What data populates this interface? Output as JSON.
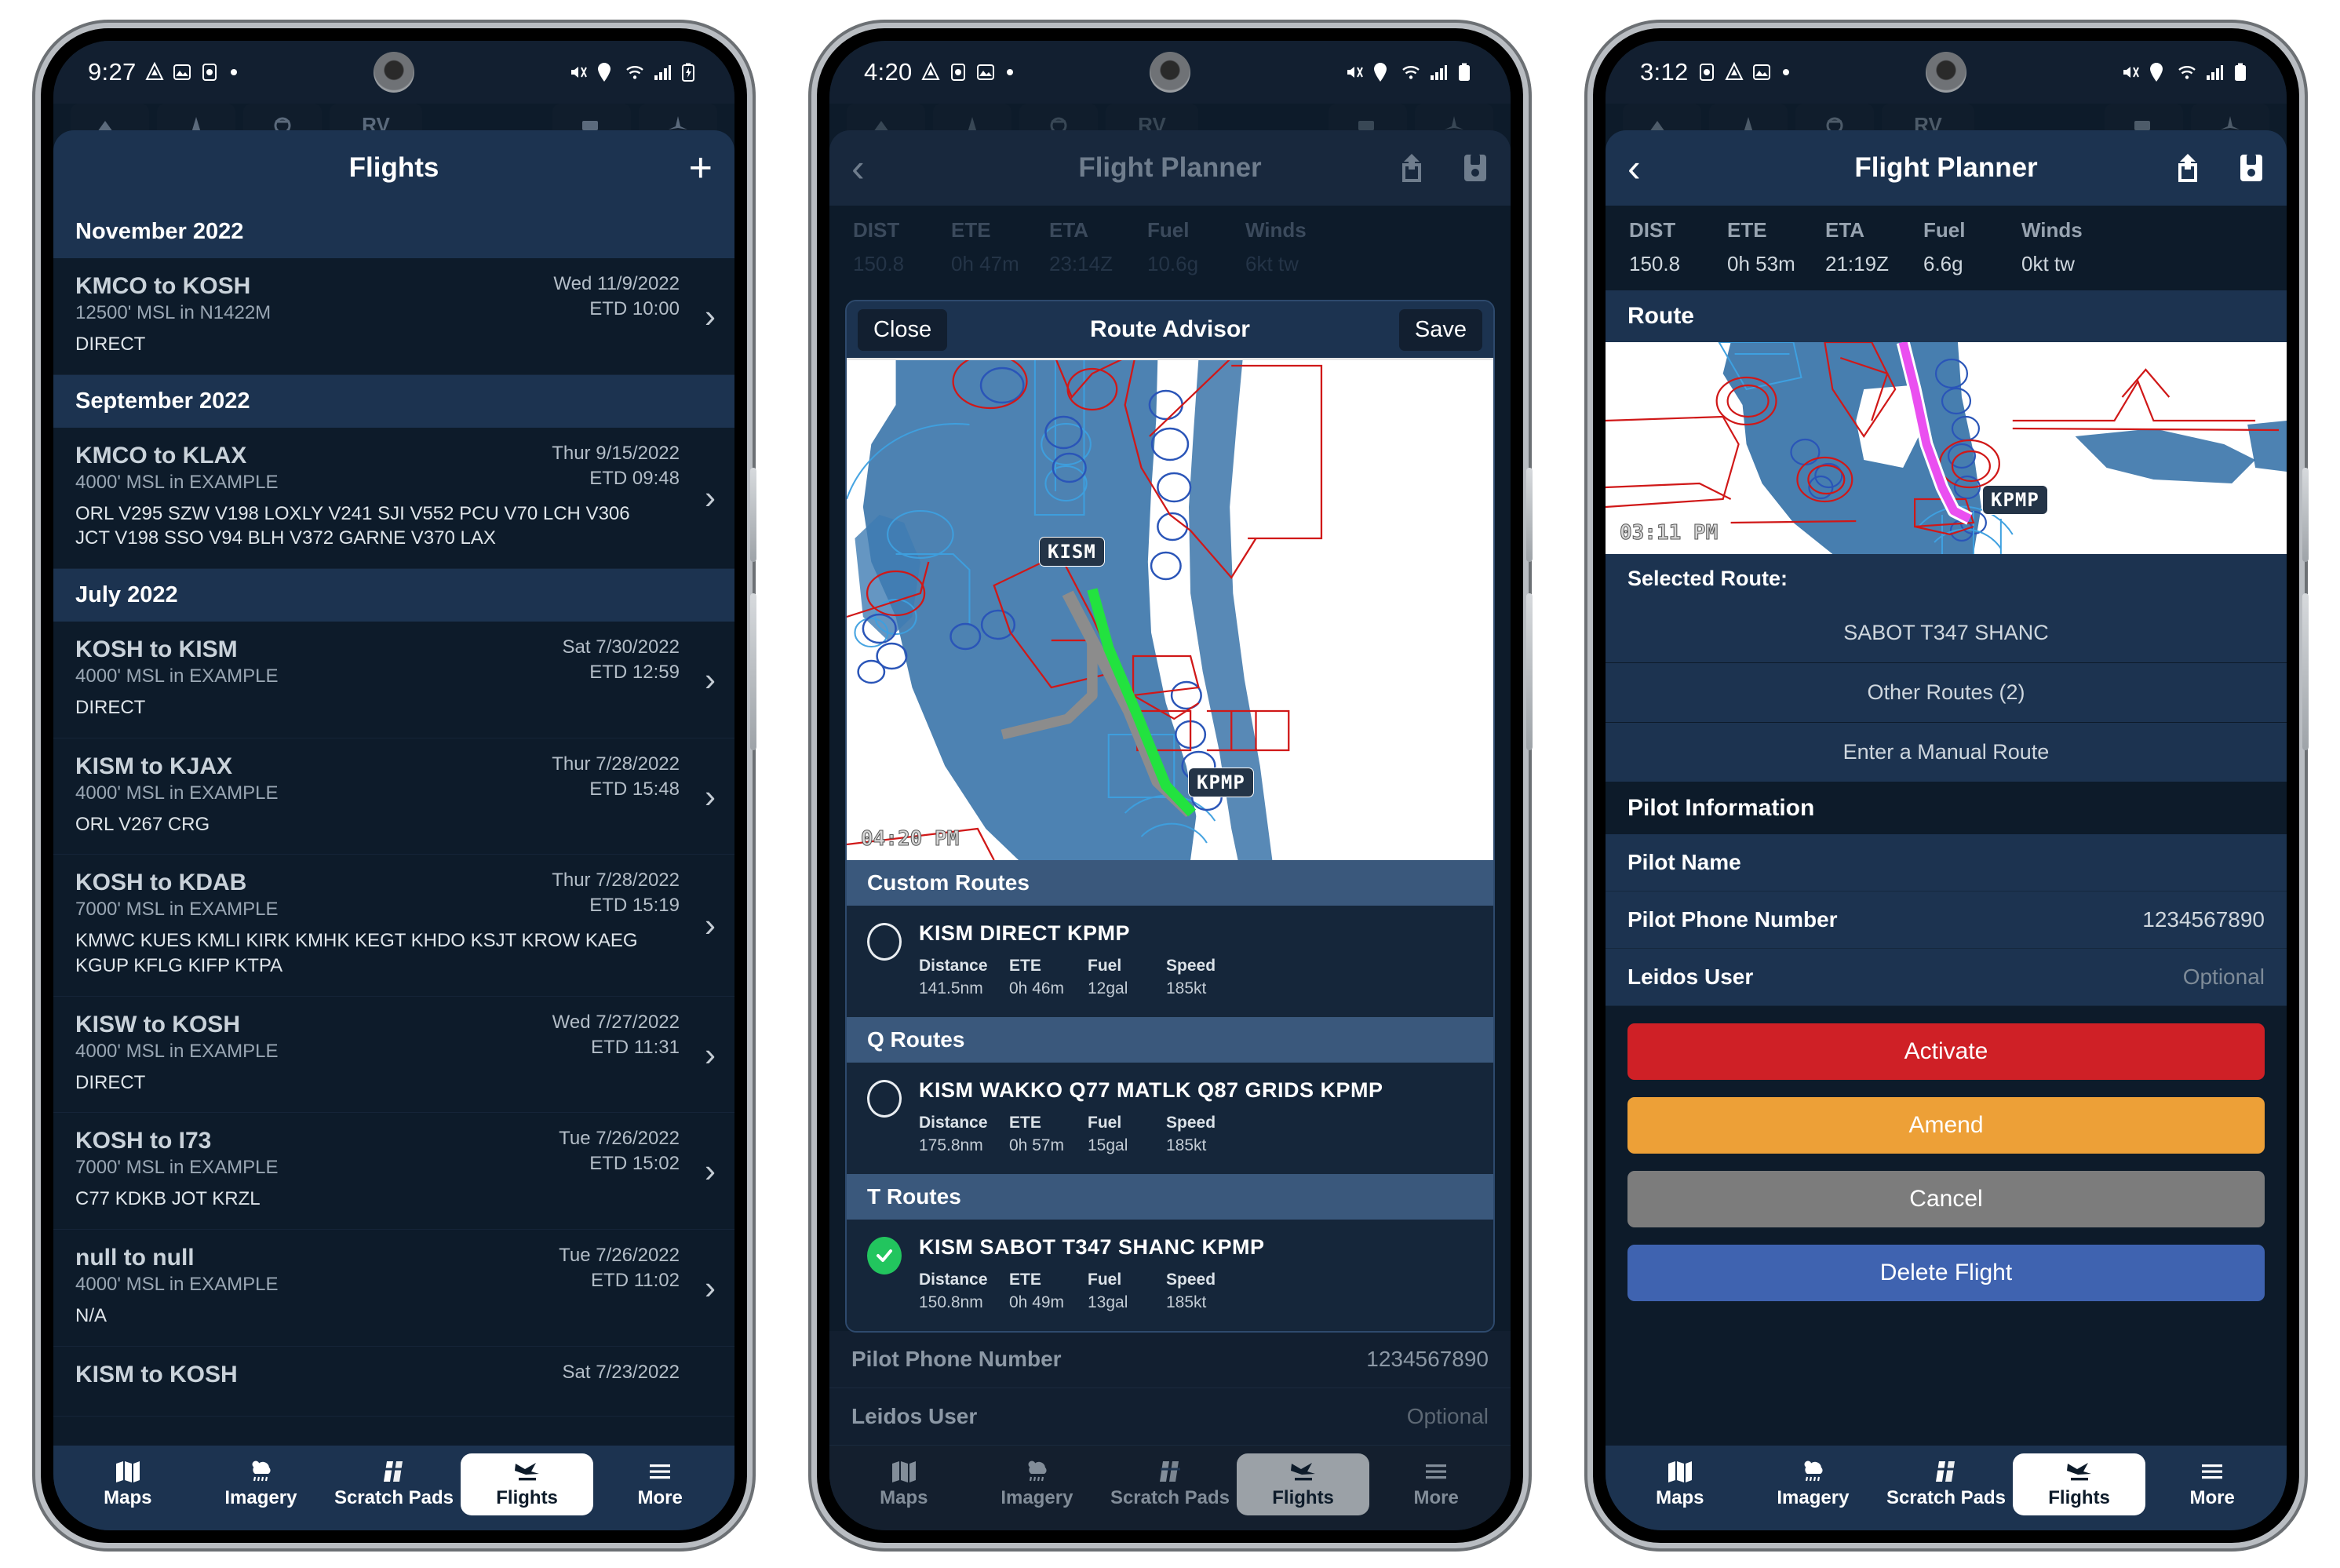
{
  "phone1": {
    "status_bar": {
      "time": "9:27",
      "icons": [
        "drive-icon",
        "photos-icon",
        "clock-icon",
        "dot-icon"
      ],
      "right_icons": [
        "mute-icon",
        "location-icon",
        "wifi-icon",
        "signal-icon",
        "battery-charging-icon"
      ]
    },
    "appbar": {
      "title": "Flights",
      "add_label": "+"
    },
    "sections": [
      {
        "month": "November 2022",
        "flights": [
          {
            "route": "KMCO to KOSH",
            "altitude": "12500' MSL in N1422M",
            "waypoints": "DIRECT",
            "date": "Wed 11/9/2022",
            "etd": "ETD 10:00"
          }
        ]
      },
      {
        "month": "September 2022",
        "flights": [
          {
            "route": "KMCO to KLAX",
            "altitude": "4000' MSL in EXAMPLE",
            "waypoints": "ORL V295 SZW V198 LOXLY V241 SJI V552 PCU V70 LCH V306 JCT V198 SSO V94 BLH V372 GARNE V370 LAX",
            "date": "Thur 9/15/2022",
            "etd": "ETD 09:48"
          }
        ]
      },
      {
        "month": "July 2022",
        "flights": [
          {
            "route": "KOSH to KISM",
            "altitude": "4000' MSL in EXAMPLE",
            "waypoints": "DIRECT",
            "date": "Sat 7/30/2022",
            "etd": "ETD 12:59"
          },
          {
            "route": "KISM to KJAX",
            "altitude": "4000' MSL in EXAMPLE",
            "waypoints": "ORL V267 CRG",
            "date": "Thur 7/28/2022",
            "etd": "ETD 15:48"
          },
          {
            "route": "KOSH to KDAB",
            "altitude": "7000' MSL in EXAMPLE",
            "waypoints": "KMWC KUES KMLI KIRK KMHK KEGT KHDO KSJT KROW KAEG KGUP KFLG KIFP KTPA",
            "date": "Thur 7/28/2022",
            "etd": "ETD 15:19"
          },
          {
            "route": "KISW to KOSH",
            "altitude": "4000' MSL in EXAMPLE",
            "waypoints": "DIRECT",
            "date": "Wed 7/27/2022",
            "etd": "ETD 11:31"
          },
          {
            "route": "KOSH to I73",
            "altitude": "7000' MSL in EXAMPLE",
            "waypoints": "C77 KDKB JOT KRZL",
            "date": "Tue 7/26/2022",
            "etd": "ETD 15:02"
          },
          {
            "route": "null to null",
            "altitude": "4000' MSL in EXAMPLE",
            "waypoints": "N/A",
            "date": "Tue 7/26/2022",
            "etd": "ETD 11:02"
          },
          {
            "route": "KISM to KOSH",
            "altitude": "",
            "waypoints": "",
            "date": "Sat 7/23/2022",
            "etd": ""
          }
        ]
      }
    ],
    "tabs": [
      {
        "label": "Maps",
        "icon": "map-icon",
        "active": false
      },
      {
        "label": "Imagery",
        "icon": "weather-cloud-icon",
        "active": false
      },
      {
        "label": "Scratch Pads",
        "icon": "scratchpad-icon",
        "active": false
      },
      {
        "label": "Flights",
        "icon": "plane-icon",
        "active": true
      },
      {
        "label": "More",
        "icon": "hamburger-icon",
        "active": false
      }
    ]
  },
  "phone2": {
    "status_bar": {
      "time": "4:20",
      "icons": [
        "drive-icon",
        "clock-icon",
        "photos-icon",
        "dot-icon"
      ],
      "right_icons": [
        "mute-icon",
        "location-icon",
        "wifi-icon",
        "signal-icon",
        "battery-icon"
      ]
    },
    "appbar": {
      "title": "Flight Planner",
      "back": "‹",
      "share_icon": "share-icon",
      "save_icon": "save-icon"
    },
    "stats": {
      "headers": [
        "DIST",
        "ETE",
        "ETA",
        "Fuel",
        "Winds"
      ],
      "values": [
        "150.8",
        "0h 47m",
        "23:14Z",
        "10.6g",
        "6kt tw"
      ]
    },
    "modal": {
      "close_label": "Close",
      "title": "Route Advisor",
      "save_label": "Save",
      "map": {
        "time": "04:20 PM",
        "origin_label": "KISM",
        "destination_label": "KPMP"
      },
      "groups": [
        {
          "name": "Custom Routes",
          "options": [
            {
              "selected": false,
              "name": "KISM  DIRECT  KPMP",
              "metric_keys": [
                "Distance",
                "ETE",
                "Fuel",
                "Speed"
              ],
              "metric_values": [
                "141.5nm",
                "0h 46m",
                "12gal",
                "185kt"
              ]
            }
          ]
        },
        {
          "name": "Q Routes",
          "options": [
            {
              "selected": false,
              "name": "KISM  WAKKO  Q77  MATLK  Q87  GRIDS  KPMP",
              "metric_keys": [
                "Distance",
                "ETE",
                "Fuel",
                "Speed"
              ],
              "metric_values": [
                "175.8nm",
                "0h 57m",
                "15gal",
                "185kt"
              ]
            }
          ]
        },
        {
          "name": "T Routes",
          "options": [
            {
              "selected": true,
              "name": "KISM  SABOT  T347  SHANC  KPMP",
              "metric_keys": [
                "Distance",
                "ETE",
                "Fuel",
                "Speed"
              ],
              "metric_values": [
                "150.8nm",
                "0h 49m",
                "13gal",
                "185kt"
              ]
            }
          ]
        }
      ]
    },
    "background_rows": [
      {
        "key": "Pilot Phone Number",
        "value": "1234567890"
      },
      {
        "key": "Leidos User",
        "value": "Optional"
      }
    ],
    "tabs": [
      {
        "label": "Maps",
        "icon": "map-icon",
        "active": false
      },
      {
        "label": "Imagery",
        "icon": "weather-cloud-icon",
        "active": false
      },
      {
        "label": "Scratch Pads",
        "icon": "scratchpad-icon",
        "active": false
      },
      {
        "label": "Flights",
        "icon": "plane-icon",
        "active": true
      },
      {
        "label": "More",
        "icon": "hamburger-icon",
        "active": false
      }
    ]
  },
  "phone3": {
    "status_bar": {
      "time": "3:12",
      "icons": [
        "clock-icon",
        "drive-icon",
        "photos-icon",
        "dot-icon"
      ],
      "right_icons": [
        "mute-icon",
        "location-icon",
        "wifi-icon",
        "signal-icon",
        "battery-icon"
      ]
    },
    "appbar": {
      "title": "Flight Planner",
      "back": "‹",
      "share_icon": "share-icon",
      "save_icon": "save-icon"
    },
    "stats": {
      "headers": [
        "DIST",
        "ETE",
        "ETA",
        "Fuel",
        "Winds"
      ],
      "values": [
        "150.8",
        "0h 53m",
        "21:19Z",
        "6.6g",
        "0kt tw"
      ]
    },
    "route_section": {
      "header": "Route",
      "map": {
        "time": "03:11 PM",
        "destination_label": "KPMP"
      },
      "selected_route_label": "Selected Route:",
      "selected_route": "SABOT T347 SHANC",
      "other_routes": "Other Routes (2)",
      "manual_route": "Enter a Manual Route"
    },
    "pilot_section": {
      "header": "Pilot Information",
      "rows": [
        {
          "key": "Pilot Name",
          "value": ""
        },
        {
          "key": "Pilot Phone Number",
          "value": "1234567890"
        },
        {
          "key": "Leidos User",
          "value": "Optional",
          "placeholder": true
        }
      ]
    },
    "actions": [
      {
        "label": "Activate",
        "color": "#cf2026"
      },
      {
        "label": "Amend",
        "color": "#eda037"
      },
      {
        "label": "Cancel",
        "color": "#7c7c7c"
      },
      {
        "label": "Delete Flight",
        "color": "#3f63b0"
      }
    ],
    "tabs": [
      {
        "label": "Maps",
        "icon": "map-icon",
        "active": false
      },
      {
        "label": "Imagery",
        "icon": "weather-cloud-icon",
        "active": false
      },
      {
        "label": "Scratch Pads",
        "icon": "scratchpad-icon",
        "active": false
      },
      {
        "label": "Flights",
        "icon": "plane-icon",
        "active": true
      },
      {
        "label": "More",
        "icon": "hamburger-icon",
        "active": false
      }
    ]
  }
}
